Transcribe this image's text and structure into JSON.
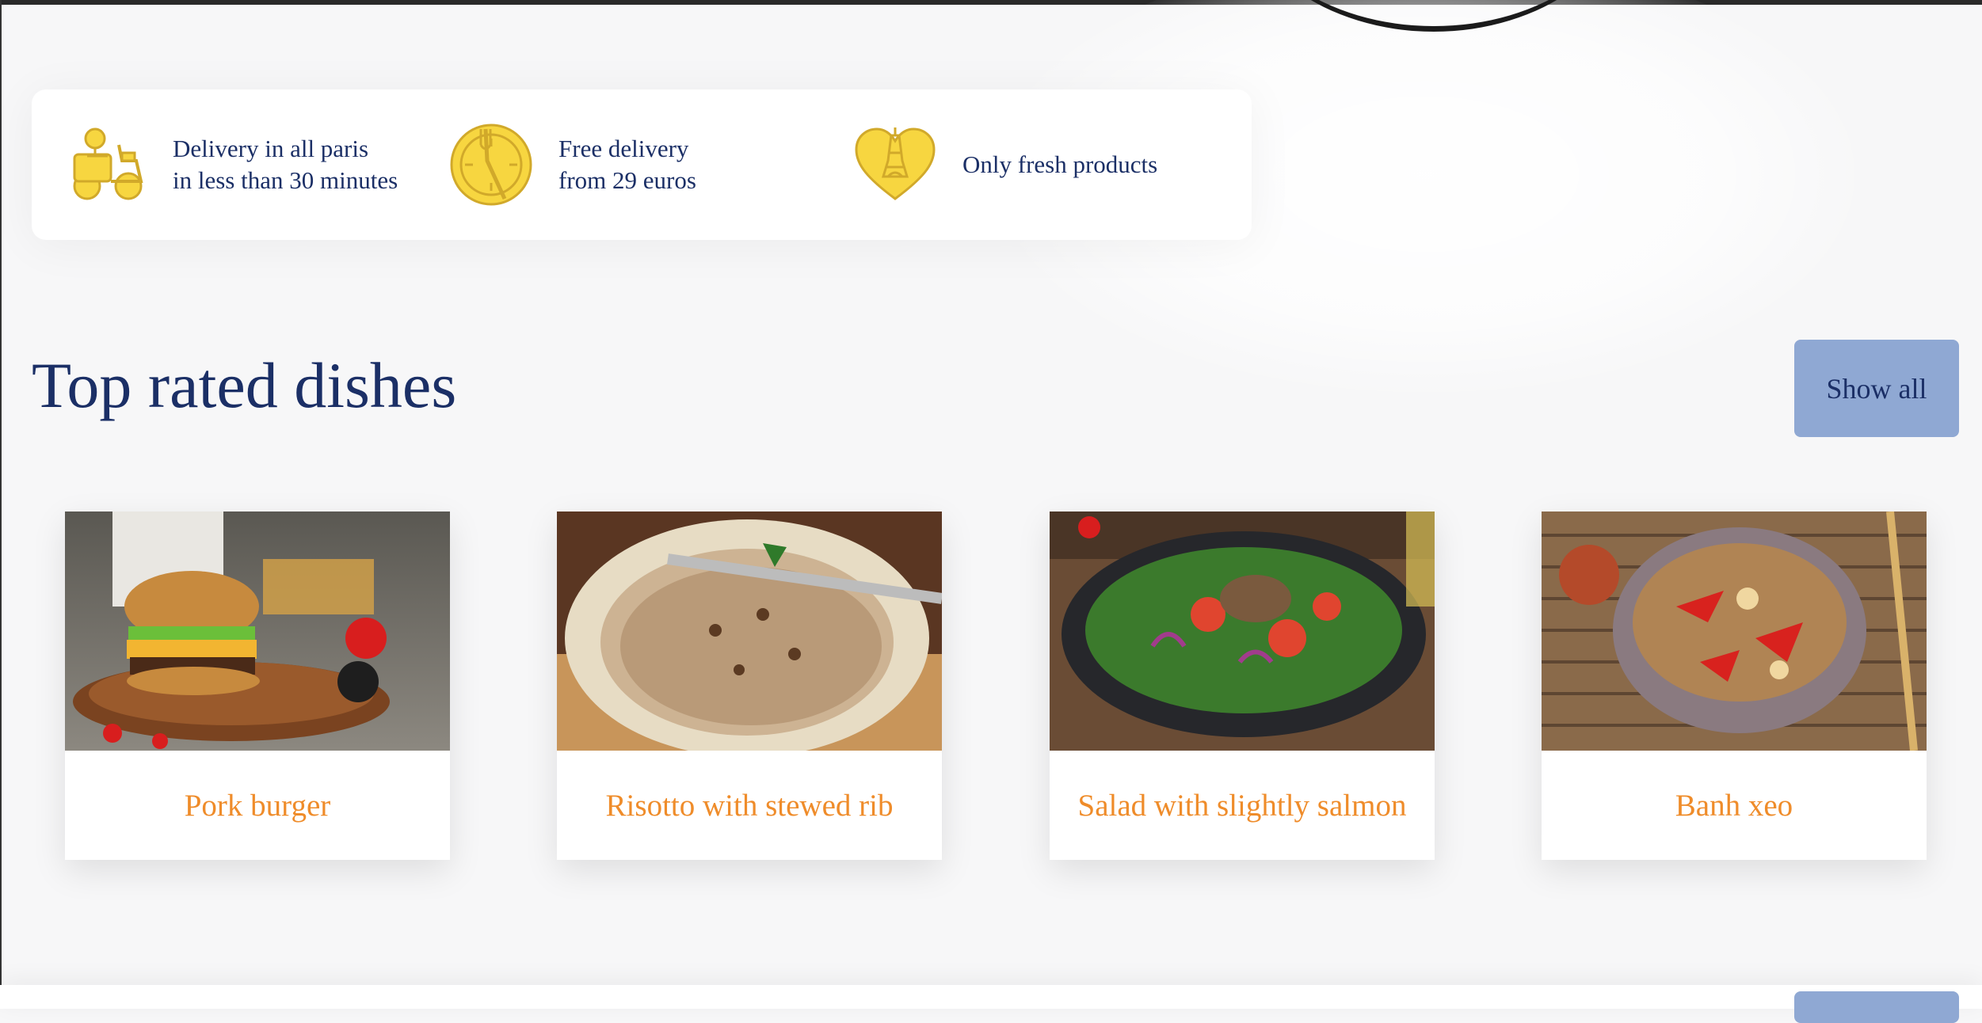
{
  "features": [
    {
      "icon": "scooter-icon",
      "lines": [
        "Delivery in all paris",
        "in less than 30 minutes"
      ]
    },
    {
      "icon": "clock-fork-icon",
      "lines": [
        "Free delivery",
        "from 29 euros"
      ]
    },
    {
      "icon": "heart-eiffel-icon",
      "lines": [
        "Only fresh products"
      ]
    }
  ],
  "section": {
    "title": "Top rated dishes",
    "show_all_label": "Show all"
  },
  "dishes": [
    {
      "name": "Pork burger",
      "image": "burger-photo"
    },
    {
      "name": "Risotto with stewed rib",
      "image": "risotto-photo"
    },
    {
      "name": "Salad with slightly salmon",
      "image": "salad-photo"
    },
    {
      "name": "Banh xeo",
      "image": "banh-xeo-photo"
    }
  ],
  "colors": {
    "primary_text": "#1b2f66",
    "accent_orange": "#ef8c2a",
    "button_blue": "#8fa8d3",
    "icon_yellow": "#f7d640"
  }
}
